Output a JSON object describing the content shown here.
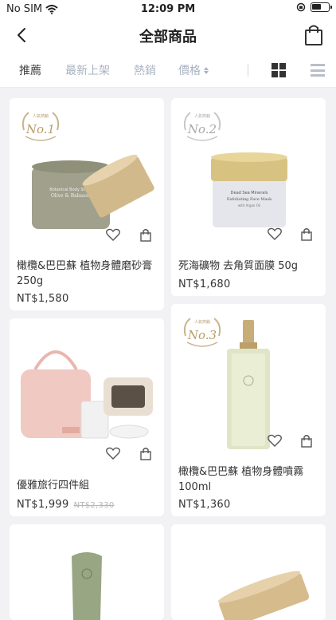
{
  "status": {
    "carrier": "No SIM",
    "time": "12:09 PM"
  },
  "nav": {
    "title": "全部商品"
  },
  "tabs": [
    {
      "label": "推薦"
    },
    {
      "label": "最新上架"
    },
    {
      "label": "熱銷"
    },
    {
      "label": "價格"
    }
  ],
  "products": [
    {
      "name": "橄欖&巴巴蘇 植物身體磨砂膏 250g",
      "price": "NT$1,580",
      "badge_top": "人氣熱銷",
      "badge": "No.1",
      "jar_label_1": "Botanical Body Scrub",
      "jar_label_2": "Olive & Babassu"
    },
    {
      "name": "死海礦物 去角質面膜 50g",
      "price": "NT$1,680",
      "badge_top": "人氣熱銷",
      "badge": "No.2",
      "jar_label_1": "Dead Sea Minerals",
      "jar_label_2": "Exfoliating Face Mask",
      "jar_label_3": "with Argan Oil"
    },
    {
      "name": "優雅旅行四件組",
      "price": "NT$1,999",
      "original_price": "NT$2,330"
    },
    {
      "name": "橄欖&巴巴蘇 植物身體噴霧 100ml",
      "price": "NT$1,360",
      "badge_top": "人氣熱銷",
      "badge": "No.3"
    }
  ],
  "icons": {
    "back": "chevron-left-icon",
    "bag": "shopping-bag-icon",
    "grid": "grid-view-icon",
    "list": "list-view-icon",
    "wishlist": "heart-icon",
    "cart": "cart-icon"
  }
}
